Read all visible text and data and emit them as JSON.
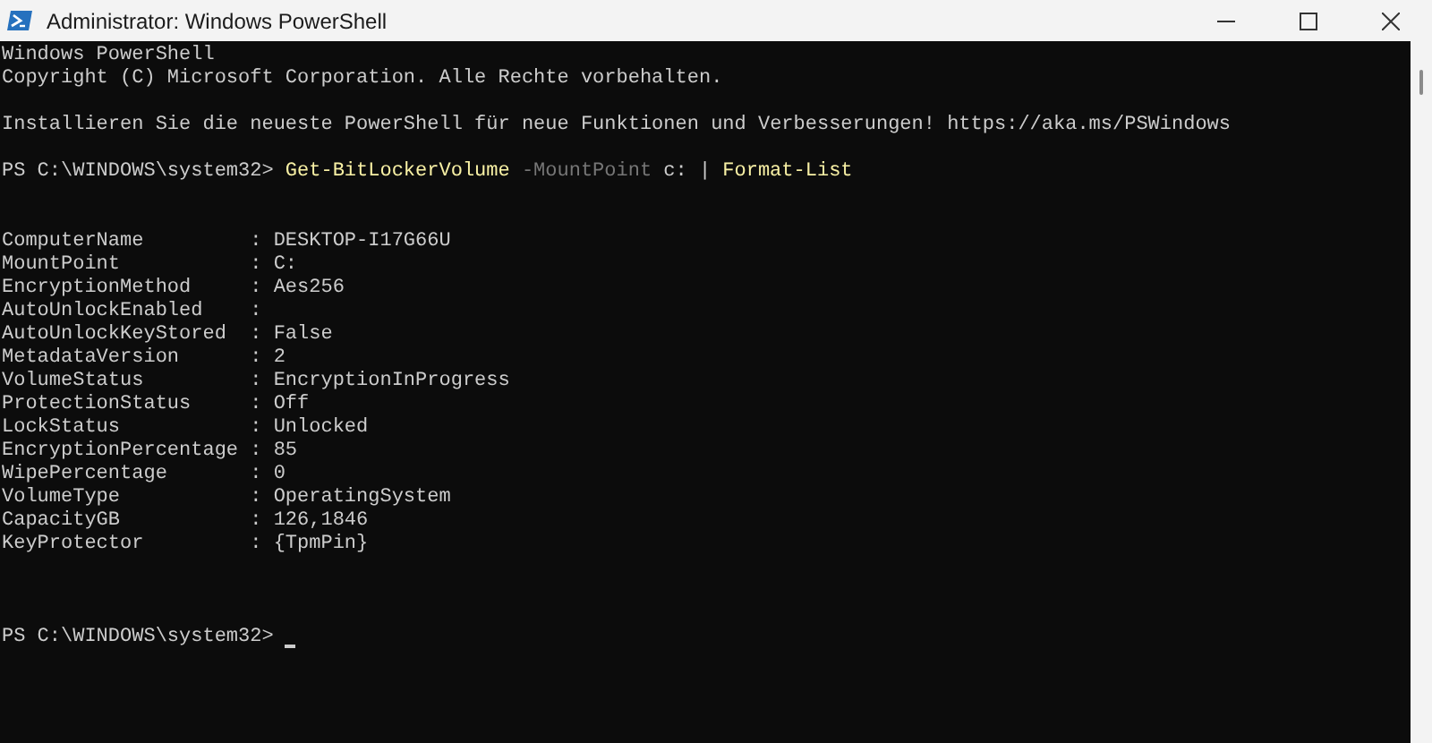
{
  "window": {
    "title": "Administrator: Windows PowerShell"
  },
  "console": [
    {
      "kind": "text",
      "text": "Windows PowerShell"
    },
    {
      "kind": "text",
      "text": "Copyright (C) Microsoft Corporation. Alle Rechte vorbehalten."
    },
    {
      "kind": "blank"
    },
    {
      "kind": "text",
      "text": "Installieren Sie die neueste PowerShell für neue Funktionen und Verbesserungen! https://aka.ms/PSWindows"
    },
    {
      "kind": "blank"
    },
    {
      "kind": "prompt",
      "prompt": "PS C:\\WINDOWS\\system32>",
      "tokens": [
        {
          "kind": "command",
          "text": "Get-BitLockerVolume"
        },
        {
          "kind": "parameter",
          "text": "-MountPoint"
        },
        {
          "kind": "argument",
          "text": "c:"
        },
        {
          "kind": "operator",
          "text": "|"
        },
        {
          "kind": "command",
          "text": "Format-List"
        }
      ],
      "cursor": false
    },
    {
      "kind": "blank"
    },
    {
      "kind": "blank"
    },
    {
      "kind": "text",
      "text": "ComputerName         : DESKTOP-I17G66U"
    },
    {
      "kind": "text",
      "text": "MountPoint           : C:"
    },
    {
      "kind": "text",
      "text": "EncryptionMethod     : Aes256"
    },
    {
      "kind": "text",
      "text": "AutoUnlockEnabled    :"
    },
    {
      "kind": "text",
      "text": "AutoUnlockKeyStored  : False"
    },
    {
      "kind": "text",
      "text": "MetadataVersion      : 2"
    },
    {
      "kind": "text",
      "text": "VolumeStatus         : EncryptionInProgress"
    },
    {
      "kind": "text",
      "text": "ProtectionStatus     : Off"
    },
    {
      "kind": "text",
      "text": "LockStatus           : Unlocked"
    },
    {
      "kind": "text",
      "text": "EncryptionPercentage : 85"
    },
    {
      "kind": "text",
      "text": "WipePercentage       : 0"
    },
    {
      "kind": "text",
      "text": "VolumeType           : OperatingSystem"
    },
    {
      "kind": "text",
      "text": "CapacityGB           : 126,1846"
    },
    {
      "kind": "text",
      "text": "KeyProtector         : {TpmPin}"
    },
    {
      "kind": "blank"
    },
    {
      "kind": "blank"
    },
    {
      "kind": "blank"
    },
    {
      "kind": "prompt",
      "prompt": "PS C:\\WINDOWS\\system32>",
      "cursor": true
    }
  ]
}
